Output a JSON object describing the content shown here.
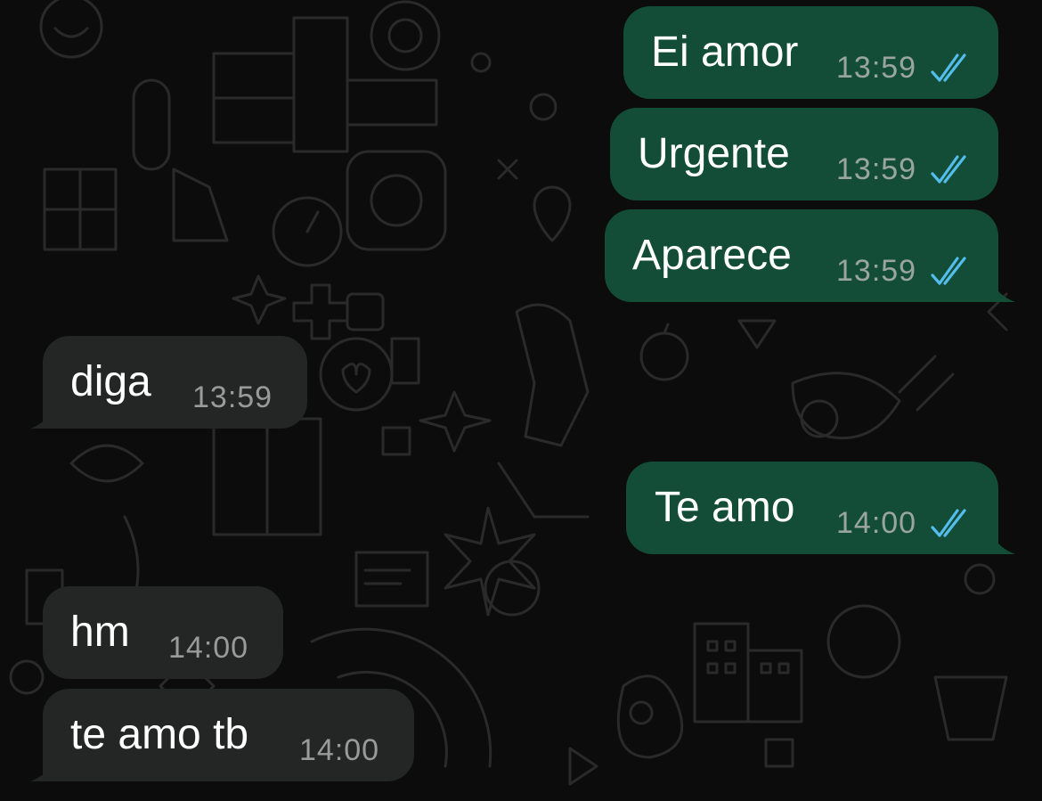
{
  "colors": {
    "background": "#0c0c0c",
    "outgoing_bubble": "#134d37",
    "incoming_bubble": "#242626",
    "read_ticks": "#53bdeb",
    "timestamp": "#9aa5a0",
    "message_text": "#ffffff"
  },
  "messages": [
    {
      "direction": "outgoing",
      "text": "Ei amor",
      "time": "13:59",
      "status": "read",
      "icon": "double-check-icon"
    },
    {
      "direction": "outgoing",
      "text": "Urgente",
      "time": "13:59",
      "status": "read",
      "icon": "double-check-icon"
    },
    {
      "direction": "outgoing",
      "text": "Aparece",
      "time": "13:59",
      "status": "read",
      "icon": "double-check-icon"
    },
    {
      "direction": "incoming",
      "text": "diga",
      "time": "13:59"
    },
    {
      "direction": "outgoing",
      "text": "Te amo",
      "time": "14:00",
      "status": "read",
      "icon": "double-check-icon"
    },
    {
      "direction": "incoming",
      "text": "hm",
      "time": "14:00"
    },
    {
      "direction": "incoming",
      "text": "te amo tb",
      "time": "14:00"
    }
  ]
}
